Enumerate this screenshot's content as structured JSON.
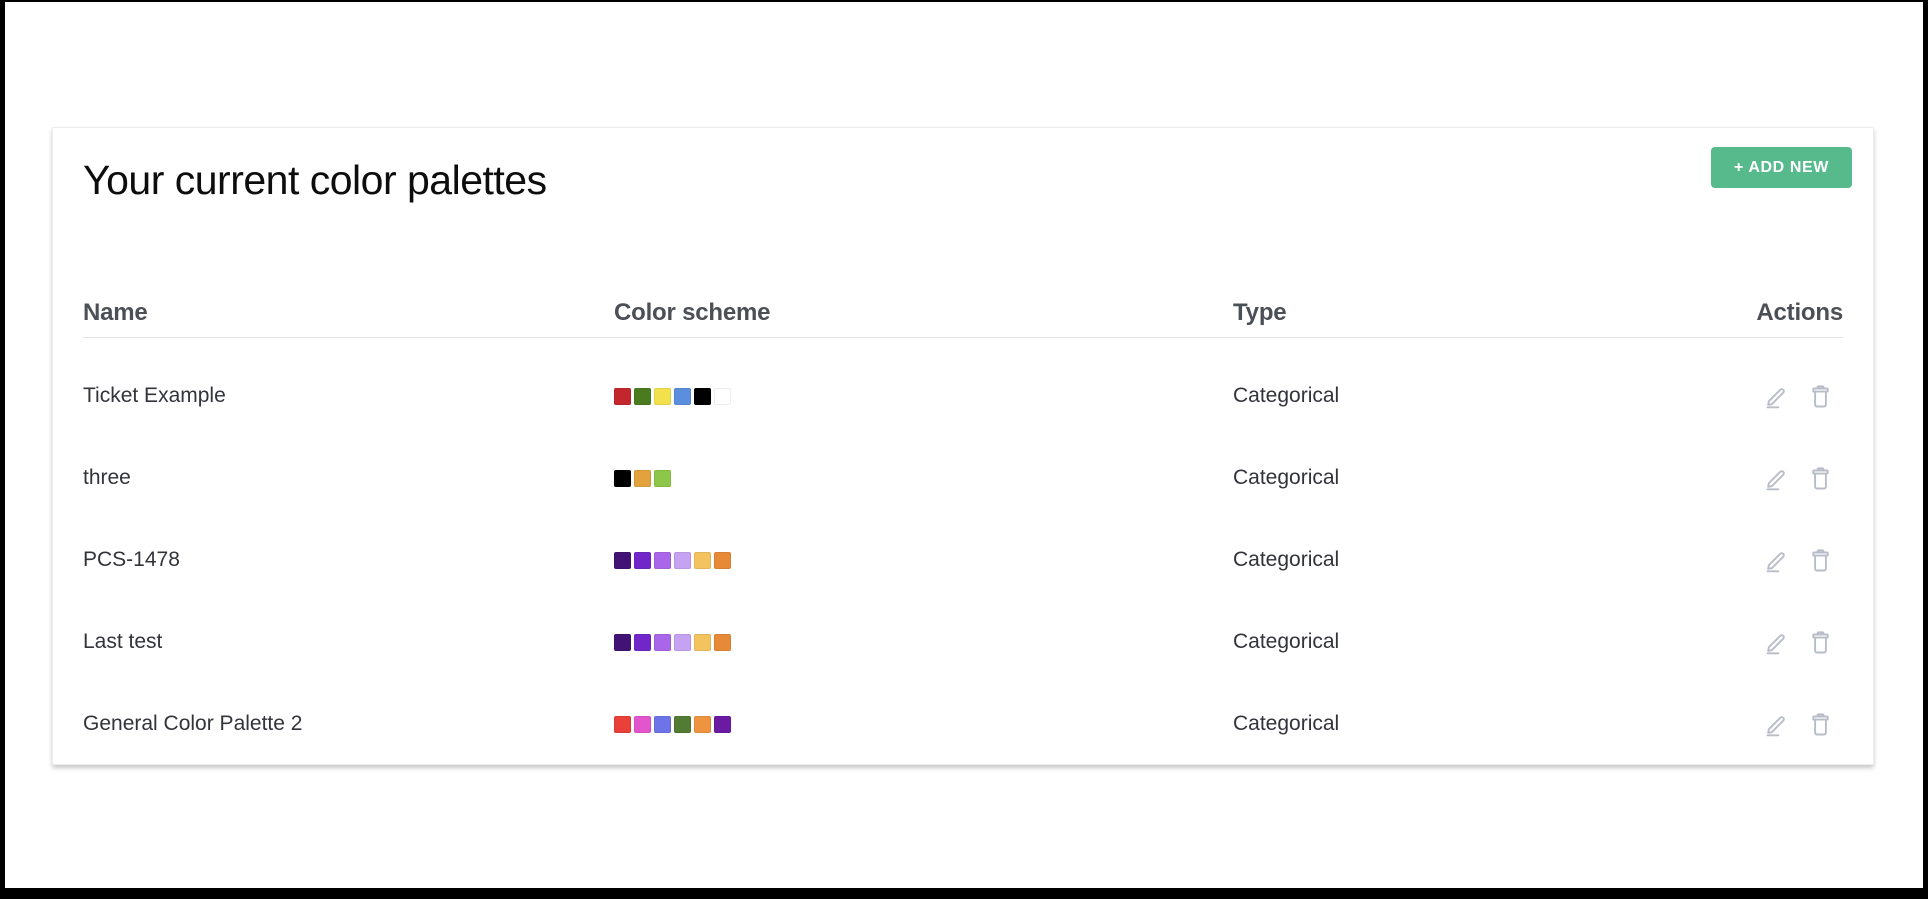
{
  "page": {
    "title": "Your current color palettes",
    "add_button_label": "+ ADD NEW",
    "accent_color": "#57ba8c",
    "icon_color": "#b7bcc8"
  },
  "table": {
    "columns": [
      "Name",
      "Color scheme",
      "Type",
      "Actions"
    ],
    "action_icons": [
      "pencil-icon",
      "trash-icon"
    ],
    "rows": [
      {
        "name": "Ticket Example",
        "type": "Categorical",
        "colors": [
          "#c1272d",
          "#4b7b1f",
          "#f2e14d",
          "#5b8edc",
          "#000000",
          "#ffffff"
        ]
      },
      {
        "name": "three",
        "type": "Categorical",
        "colors": [
          "#000000",
          "#e2a33e",
          "#8cc74a"
        ]
      },
      {
        "name": "PCS-1478",
        "type": "Categorical",
        "colors": [
          "#421374",
          "#7127c8",
          "#a966e8",
          "#c6a3f2",
          "#f3c360",
          "#e68a38"
        ]
      },
      {
        "name": "Last test",
        "type": "Categorical",
        "colors": [
          "#421374",
          "#7127c8",
          "#a966e8",
          "#c6a3f2",
          "#f3c360",
          "#e68a38"
        ]
      },
      {
        "name": "General Color Palette 2",
        "type": "Categorical",
        "colors": [
          "#e94039",
          "#e355cd",
          "#6d74e8",
          "#527b33",
          "#ee9440",
          "#6b1ba3"
        ]
      }
    ]
  }
}
